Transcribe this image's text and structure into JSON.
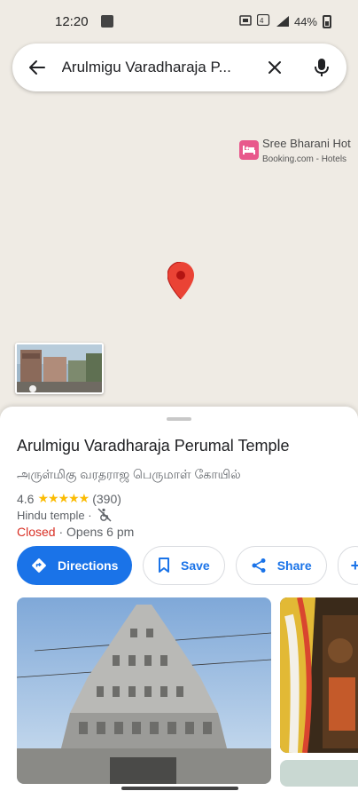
{
  "status_bar": {
    "time": "12:20",
    "network_label": "4G",
    "battery": "44%"
  },
  "search": {
    "query": "Arulmigu Varadharaja P..."
  },
  "map": {
    "poi": {
      "name": "Sree Bharani Hot",
      "subtitle": "Booking.com - Hotels"
    }
  },
  "place": {
    "title": "Arulmigu Varadharaja Perumal Temple",
    "alt_name": "அருள்மிகு வரதராஜ பெருமாள் கோயில்",
    "rating": "4.6",
    "stars": "★★★★★",
    "reviews": "(390)",
    "category": "Hindu temple ·",
    "status": "Closed",
    "opens": " · Opens 6 pm"
  },
  "actions": {
    "directions": "Directions",
    "save": "Save",
    "share": "Share",
    "more": "+"
  },
  "colors": {
    "accent": "#1a73e8",
    "closed": "#d93025",
    "star": "#fbbc04",
    "map_bg": "#efebe4"
  }
}
